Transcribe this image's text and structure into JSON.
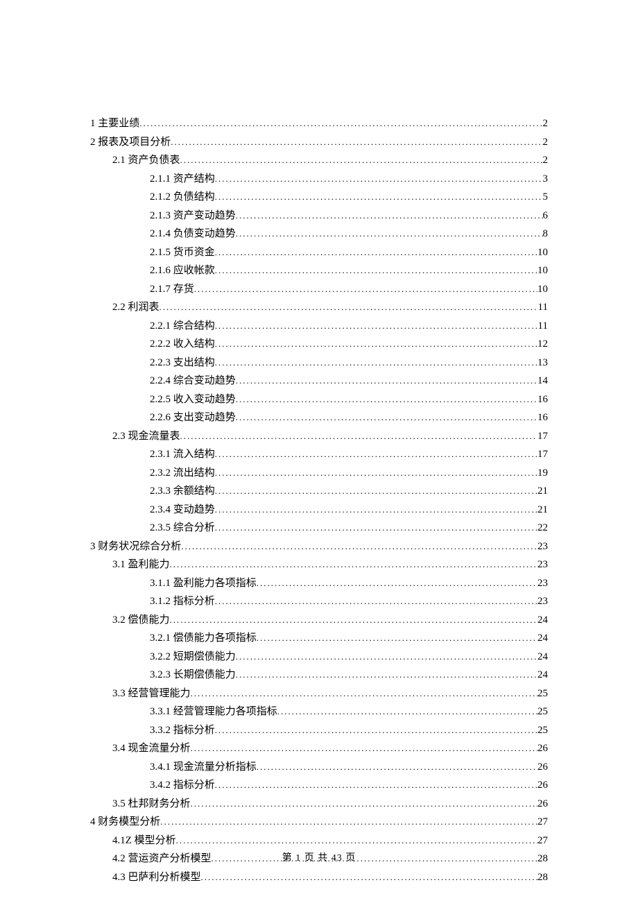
{
  "toc": [
    {
      "level": 1,
      "label": "1 主要业绩",
      "page": "2"
    },
    {
      "level": 1,
      "label": "2 报表及项目分析",
      "page": "2"
    },
    {
      "level": 2,
      "label": "2.1 资产负债表",
      "page": "2"
    },
    {
      "level": 3,
      "label": "2.1.1 资产结构",
      "page": "3"
    },
    {
      "level": 3,
      "label": "2.1.2 负债结构",
      "page": "5"
    },
    {
      "level": 3,
      "label": "2.1.3 资产变动趋势",
      "page": "6"
    },
    {
      "level": 3,
      "label": "2.1.4 负债变动趋势",
      "page": "8"
    },
    {
      "level": 3,
      "label": "2.1.5 货币资金",
      "page": "10"
    },
    {
      "level": 3,
      "label": "2.1.6 应收帐款",
      "page": "10"
    },
    {
      "level": 3,
      "label": "2.1.7 存货",
      "page": "10"
    },
    {
      "level": 2,
      "label": "2.2 利润表",
      "page": "11"
    },
    {
      "level": 3,
      "label": "2.2.1 综合结构",
      "page": "11"
    },
    {
      "level": 3,
      "label": "2.2.2 收入结构",
      "page": "12"
    },
    {
      "level": 3,
      "label": "2.2.3 支出结构",
      "page": "13"
    },
    {
      "level": 3,
      "label": "2.2.4 综合变动趋势",
      "page": "14"
    },
    {
      "level": 3,
      "label": "2.2.5 收入变动趋势",
      "page": "16"
    },
    {
      "level": 3,
      "label": "2.2.6 支出变动趋势",
      "page": "16"
    },
    {
      "level": 2,
      "label": "2.3 现金流量表",
      "page": "17"
    },
    {
      "level": 3,
      "label": "2.3.1 流入结构",
      "page": "17"
    },
    {
      "level": 3,
      "label": "2.3.2 流出结构",
      "page": "19"
    },
    {
      "level": 3,
      "label": "2.3.3 余额结构",
      "page": "21"
    },
    {
      "level": 3,
      "label": "2.3.4 变动趋势",
      "page": "21"
    },
    {
      "level": 3,
      "label": "2.3.5 综合分析",
      "page": "22"
    },
    {
      "level": 1,
      "label": "3 财务状况综合分析",
      "page": "23"
    },
    {
      "level": 2,
      "label": "3.1 盈利能力",
      "page": "23"
    },
    {
      "level": 3,
      "label": "3.1.1 盈利能力各项指标",
      "page": "23"
    },
    {
      "level": 3,
      "label": "3.1.2 指标分析",
      "page": "23"
    },
    {
      "level": 2,
      "label": "3.2 偿债能力",
      "page": "24"
    },
    {
      "level": 3,
      "label": "3.2.1 偿债能力各项指标",
      "page": "24"
    },
    {
      "level": 3,
      "label": "3.2.2 短期偿债能力",
      "page": "24"
    },
    {
      "level": 3,
      "label": "3.2.3 长期偿债能力",
      "page": "24"
    },
    {
      "level": 2,
      "label": "3.3 经营管理能力",
      "page": "25"
    },
    {
      "level": 3,
      "label": "3.3.1 经营管理能力各项指标",
      "page": "25"
    },
    {
      "level": 3,
      "label": "3.3.2 指标分析",
      "page": "25"
    },
    {
      "level": 2,
      "label": "3.4 现金流量分析",
      "page": "26"
    },
    {
      "level": 3,
      "label": "3.4.1 现金流量分析指标",
      "page": "26"
    },
    {
      "level": 3,
      "label": "3.4.2 指标分析",
      "page": "26"
    },
    {
      "level": 2,
      "label": "3.5 杜邦财务分析",
      "page": "26"
    },
    {
      "level": 1,
      "label": "4 财务模型分析",
      "page": "27"
    },
    {
      "level": 2,
      "label": "4.1Z 模型分析",
      "page": "27"
    },
    {
      "level": 2,
      "label": "4.2 营运资产分析模型",
      "page": "28"
    },
    {
      "level": 2,
      "label": "4.3 巴萨利分析模型",
      "page": "28"
    }
  ],
  "footer": "第 1 页 共 43 页"
}
